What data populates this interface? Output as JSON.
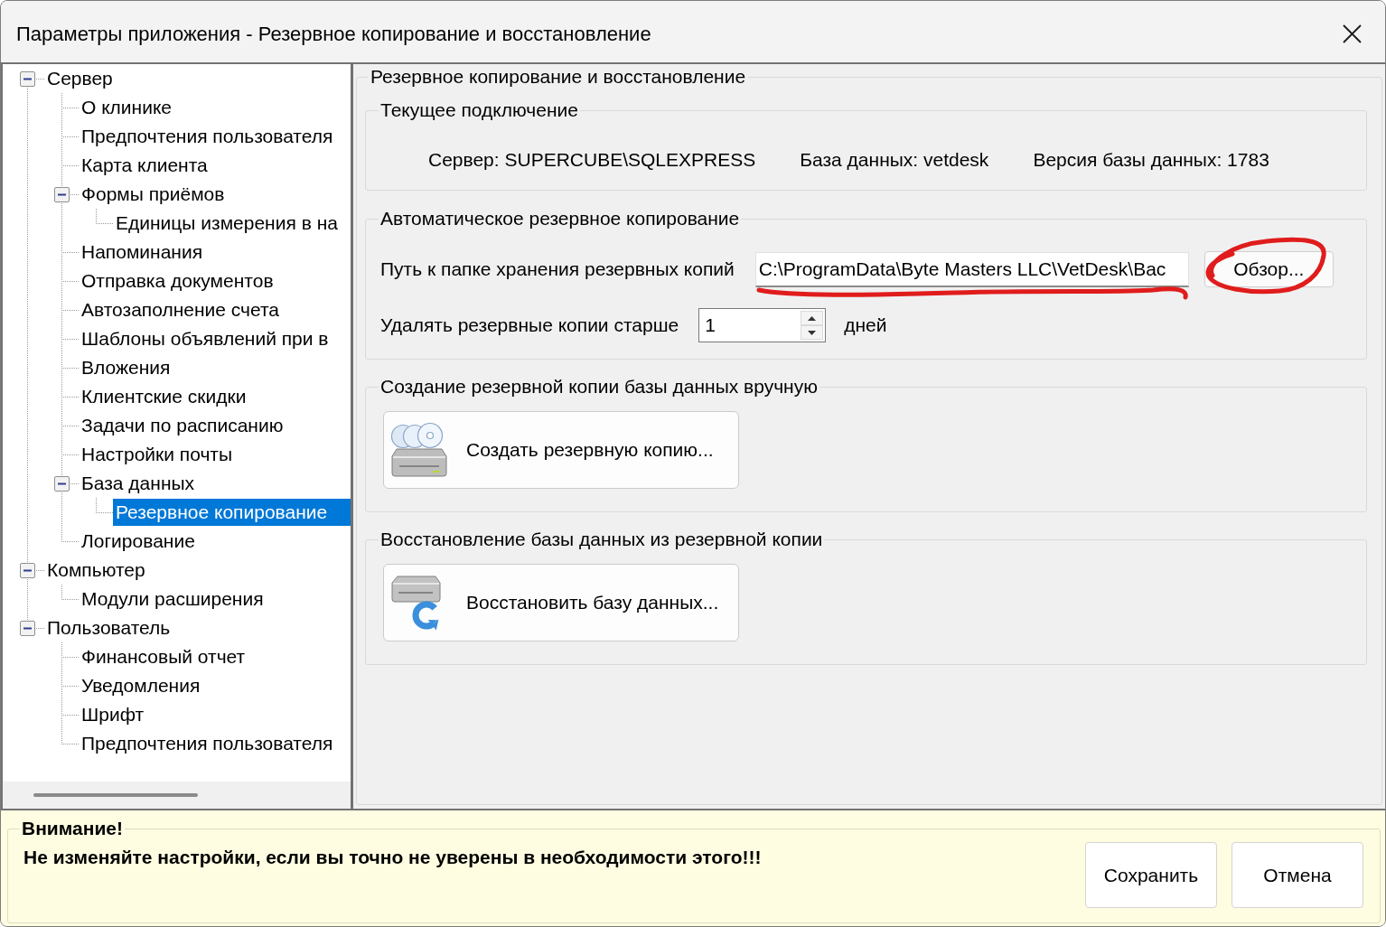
{
  "window": {
    "title": "Параметры приложения - Резервное копирование и восстановление"
  },
  "tree": {
    "items": [
      {
        "label": "Сервер",
        "selected": false,
        "expanded": true,
        "children": [
          {
            "label": "О клинике",
            "selected": false
          },
          {
            "label": "Предпочтения пользователя",
            "selected": false
          },
          {
            "label": "Карта клиента",
            "selected": false
          },
          {
            "label": "Формы приёмов",
            "selected": false,
            "expanded": true,
            "children": [
              {
                "label": "Единицы измерения в на",
                "selected": false
              }
            ]
          },
          {
            "label": "Напоминания",
            "selected": false
          },
          {
            "label": "Отправка документов",
            "selected": false
          },
          {
            "label": "Автозаполнение счета",
            "selected": false
          },
          {
            "label": "Шаблоны объявлений при в",
            "selected": false
          },
          {
            "label": "Вложения",
            "selected": false
          },
          {
            "label": "Клиентские скидки",
            "selected": false
          },
          {
            "label": "Задачи по расписанию",
            "selected": false
          },
          {
            "label": "Настройки почты",
            "selected": false
          },
          {
            "label": "База данных",
            "selected": false,
            "expanded": true,
            "children": [
              {
                "label": "Резервное копирование",
                "selected": true
              }
            ]
          },
          {
            "label": "Логирование",
            "selected": false
          }
        ]
      },
      {
        "label": "Компьютер",
        "selected": false,
        "expanded": true,
        "children": [
          {
            "label": "Модули расширения",
            "selected": false
          }
        ]
      },
      {
        "label": "Пользователь",
        "selected": false,
        "expanded": true,
        "children": [
          {
            "label": "Финансовый отчет",
            "selected": false
          },
          {
            "label": "Уведомления",
            "selected": false
          },
          {
            "label": "Шрифт",
            "selected": false
          },
          {
            "label": "Предпочтения пользователя",
            "selected": false
          }
        ]
      }
    ]
  },
  "settings": {
    "title": "Резервное копирование и восстановление",
    "connection": {
      "title": "Текущее подключение",
      "items": [
        "Сервер: SUPERCUBE\\SQLEXPRESS",
        "База данных: vetdesk",
        "Версия базы данных: 1783"
      ]
    },
    "automatic": {
      "title": "Автоматическое резервное копирование",
      "path": {
        "label": "Путь к папке хранения резервных копий",
        "value": "C:\\ProgramData\\Byte Masters LLC\\VetDesk\\Bac",
        "marked": true
      },
      "browse": {
        "label": "Обзор...",
        "marked": true
      },
      "retention": {
        "label": "Удалять резервные копии старше",
        "value": "1",
        "unit": "дней"
      }
    },
    "actions": [
      {
        "kind": "backup",
        "title": "Создание резервной копии базы данных вручную",
        "button": "Создать резервную копию..."
      },
      {
        "kind": "restore",
        "title": "Восстановление базы данных из резервной копии",
        "button": "Восстановить базу данных..."
      }
    ]
  },
  "warning": {
    "title": "Внимание!",
    "message": "Не изменяйте настройки, если вы точно не уверены в необходимости этого!!!",
    "buttons": [
      "Сохранить",
      "Отмена"
    ]
  }
}
